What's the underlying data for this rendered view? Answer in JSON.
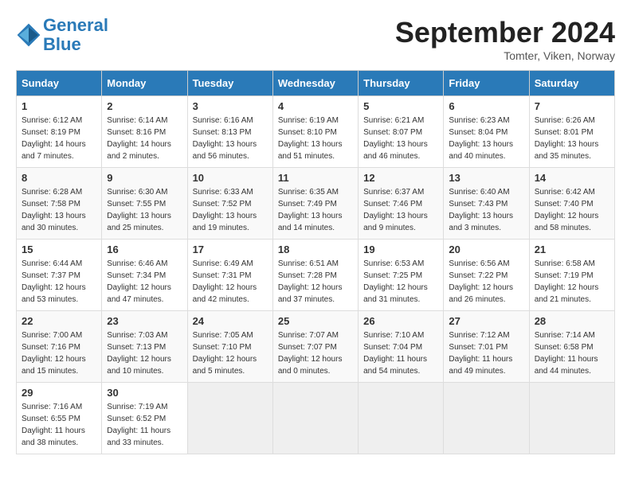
{
  "logo": {
    "line1": "General",
    "line2": "Blue"
  },
  "title": "September 2024",
  "location": "Tomter, Viken, Norway",
  "days_of_week": [
    "Sunday",
    "Monday",
    "Tuesday",
    "Wednesday",
    "Thursday",
    "Friday",
    "Saturday"
  ],
  "weeks": [
    [
      {
        "day": "1",
        "info": "Sunrise: 6:12 AM\nSunset: 8:19 PM\nDaylight: 14 hours\nand 7 minutes."
      },
      {
        "day": "2",
        "info": "Sunrise: 6:14 AM\nSunset: 8:16 PM\nDaylight: 14 hours\nand 2 minutes."
      },
      {
        "day": "3",
        "info": "Sunrise: 6:16 AM\nSunset: 8:13 PM\nDaylight: 13 hours\nand 56 minutes."
      },
      {
        "day": "4",
        "info": "Sunrise: 6:19 AM\nSunset: 8:10 PM\nDaylight: 13 hours\nand 51 minutes."
      },
      {
        "day": "5",
        "info": "Sunrise: 6:21 AM\nSunset: 8:07 PM\nDaylight: 13 hours\nand 46 minutes."
      },
      {
        "day": "6",
        "info": "Sunrise: 6:23 AM\nSunset: 8:04 PM\nDaylight: 13 hours\nand 40 minutes."
      },
      {
        "day": "7",
        "info": "Sunrise: 6:26 AM\nSunset: 8:01 PM\nDaylight: 13 hours\nand 35 minutes."
      }
    ],
    [
      {
        "day": "8",
        "info": "Sunrise: 6:28 AM\nSunset: 7:58 PM\nDaylight: 13 hours\nand 30 minutes."
      },
      {
        "day": "9",
        "info": "Sunrise: 6:30 AM\nSunset: 7:55 PM\nDaylight: 13 hours\nand 25 minutes."
      },
      {
        "day": "10",
        "info": "Sunrise: 6:33 AM\nSunset: 7:52 PM\nDaylight: 13 hours\nand 19 minutes."
      },
      {
        "day": "11",
        "info": "Sunrise: 6:35 AM\nSunset: 7:49 PM\nDaylight: 13 hours\nand 14 minutes."
      },
      {
        "day": "12",
        "info": "Sunrise: 6:37 AM\nSunset: 7:46 PM\nDaylight: 13 hours\nand 9 minutes."
      },
      {
        "day": "13",
        "info": "Sunrise: 6:40 AM\nSunset: 7:43 PM\nDaylight: 13 hours\nand 3 minutes."
      },
      {
        "day": "14",
        "info": "Sunrise: 6:42 AM\nSunset: 7:40 PM\nDaylight: 12 hours\nand 58 minutes."
      }
    ],
    [
      {
        "day": "15",
        "info": "Sunrise: 6:44 AM\nSunset: 7:37 PM\nDaylight: 12 hours\nand 53 minutes."
      },
      {
        "day": "16",
        "info": "Sunrise: 6:46 AM\nSunset: 7:34 PM\nDaylight: 12 hours\nand 47 minutes."
      },
      {
        "day": "17",
        "info": "Sunrise: 6:49 AM\nSunset: 7:31 PM\nDaylight: 12 hours\nand 42 minutes."
      },
      {
        "day": "18",
        "info": "Sunrise: 6:51 AM\nSunset: 7:28 PM\nDaylight: 12 hours\nand 37 minutes."
      },
      {
        "day": "19",
        "info": "Sunrise: 6:53 AM\nSunset: 7:25 PM\nDaylight: 12 hours\nand 31 minutes."
      },
      {
        "day": "20",
        "info": "Sunrise: 6:56 AM\nSunset: 7:22 PM\nDaylight: 12 hours\nand 26 minutes."
      },
      {
        "day": "21",
        "info": "Sunrise: 6:58 AM\nSunset: 7:19 PM\nDaylight: 12 hours\nand 21 minutes."
      }
    ],
    [
      {
        "day": "22",
        "info": "Sunrise: 7:00 AM\nSunset: 7:16 PM\nDaylight: 12 hours\nand 15 minutes."
      },
      {
        "day": "23",
        "info": "Sunrise: 7:03 AM\nSunset: 7:13 PM\nDaylight: 12 hours\nand 10 minutes."
      },
      {
        "day": "24",
        "info": "Sunrise: 7:05 AM\nSunset: 7:10 PM\nDaylight: 12 hours\nand 5 minutes."
      },
      {
        "day": "25",
        "info": "Sunrise: 7:07 AM\nSunset: 7:07 PM\nDaylight: 12 hours\nand 0 minutes."
      },
      {
        "day": "26",
        "info": "Sunrise: 7:10 AM\nSunset: 7:04 PM\nDaylight: 11 hours\nand 54 minutes."
      },
      {
        "day": "27",
        "info": "Sunrise: 7:12 AM\nSunset: 7:01 PM\nDaylight: 11 hours\nand 49 minutes."
      },
      {
        "day": "28",
        "info": "Sunrise: 7:14 AM\nSunset: 6:58 PM\nDaylight: 11 hours\nand 44 minutes."
      }
    ],
    [
      {
        "day": "29",
        "info": "Sunrise: 7:16 AM\nSunset: 6:55 PM\nDaylight: 11 hours\nand 38 minutes."
      },
      {
        "day": "30",
        "info": "Sunrise: 7:19 AM\nSunset: 6:52 PM\nDaylight: 11 hours\nand 33 minutes."
      },
      null,
      null,
      null,
      null,
      null
    ]
  ]
}
